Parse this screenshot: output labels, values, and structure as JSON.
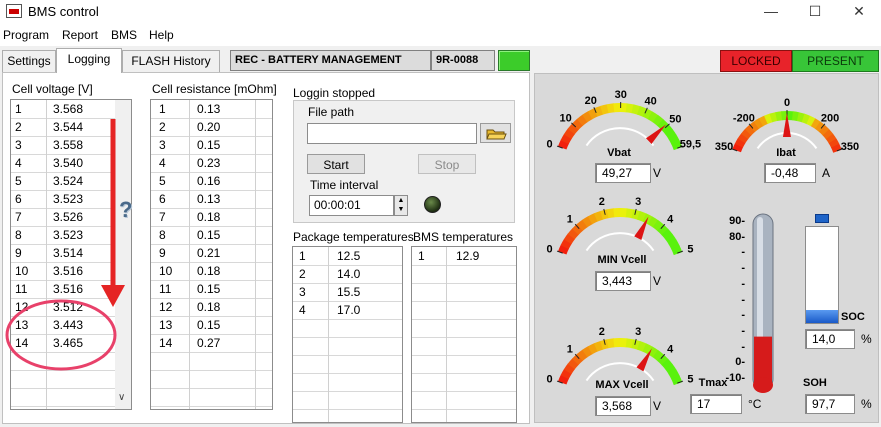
{
  "window": {
    "title": "BMS control"
  },
  "menu": [
    "Program",
    "Report",
    "BMS",
    "Help"
  ],
  "tabs": [
    "Settings",
    "Logging",
    "FLASH History"
  ],
  "header": {
    "system": "REC - BATTERY MANAGEMENT",
    "serial": "9R-0088"
  },
  "status": {
    "locked": "LOCKED",
    "present": "PRESENT"
  },
  "cell_voltage": {
    "title": "Cell voltage [V]",
    "rows": [
      [
        "1",
        "3.568"
      ],
      [
        "2",
        "3.544"
      ],
      [
        "3",
        "3.558"
      ],
      [
        "4",
        "3.540"
      ],
      [
        "5",
        "3.524"
      ],
      [
        "6",
        "3.523"
      ],
      [
        "7",
        "3.526"
      ],
      [
        "8",
        "3.523"
      ],
      [
        "9",
        "3.514"
      ],
      [
        "10",
        "3.516"
      ],
      [
        "11",
        "3.516"
      ],
      [
        "12",
        "3.512"
      ],
      [
        "13",
        "3.443"
      ],
      [
        "14",
        "3.465"
      ]
    ]
  },
  "cell_resistance": {
    "title": "Cell resistance [mOhm]",
    "rows": [
      [
        "1",
        "0.13"
      ],
      [
        "2",
        "0.20"
      ],
      [
        "3",
        "0.15"
      ],
      [
        "4",
        "0.23"
      ],
      [
        "5",
        "0.16"
      ],
      [
        "6",
        "0.13"
      ],
      [
        "7",
        "0.18"
      ],
      [
        "8",
        "0.15"
      ],
      [
        "9",
        "0.21"
      ],
      [
        "10",
        "0.18"
      ],
      [
        "11",
        "0.15"
      ],
      [
        "12",
        "0.18"
      ],
      [
        "13",
        "0.15"
      ],
      [
        "14",
        "0.27"
      ]
    ]
  },
  "logging": {
    "status": "Loggin stopped",
    "file_path_label": "File path",
    "file_path_value": "",
    "start_label": "Start",
    "stop_label": "Stop",
    "interval_label": "Time interval",
    "interval_value": "00:00:01"
  },
  "package_temps": {
    "title": "Package temperatures",
    "rows": [
      [
        "1",
        "12.5"
      ],
      [
        "2",
        "14.0"
      ],
      [
        "3",
        "15.5"
      ],
      [
        "4",
        "17.0"
      ]
    ]
  },
  "bms_temps": {
    "title": "BMS temperatures",
    "rows": [
      [
        "1",
        "12.9"
      ]
    ]
  },
  "gauges": {
    "vbat": {
      "label": "Vbat",
      "value": "49,27",
      "unit": "V",
      "ticks": [
        "0",
        "10",
        "20",
        "30",
        "40",
        "50",
        "59,5"
      ],
      "reading": 49.27
    },
    "ibat": {
      "label": "Ibat",
      "value": "-0,48",
      "unit": "A",
      "ticks": [
        "350",
        "-200",
        "0",
        "200",
        "350"
      ],
      "reading": -0.48
    },
    "min_vcell": {
      "label": "MIN Vcell",
      "value": "3,443",
      "unit": "V",
      "ticks": [
        "0",
        "1",
        "2",
        "3",
        "4",
        "5"
      ],
      "reading": 3.443
    },
    "max_vcell": {
      "label": "MAX Vcell",
      "value": "3,568",
      "unit": "V",
      "ticks": [
        "0",
        "1",
        "2",
        "3",
        "4",
        "5"
      ],
      "reading": 3.568
    }
  },
  "thermo": {
    "label": "Tmax",
    "value": "17",
    "unit": "°C",
    "ticks": [
      "90",
      "80",
      "70",
      "60",
      "50",
      "40",
      "30",
      "20",
      "10",
      "0",
      "-10"
    ],
    "reading": 17
  },
  "soc": {
    "label": "SOC",
    "value": "14,0",
    "unit": "%",
    "level": 0.14
  },
  "soh": {
    "label": "SOH",
    "value": "97,7",
    "unit": "%"
  },
  "annotation": {
    "mark": "?"
  },
  "colors": {
    "locked": "#e8232a",
    "present": "#38c538",
    "led": "#3ccc2a",
    "arrow": "#e52424",
    "circle": "#e8416a",
    "needle": "#dd1414"
  }
}
